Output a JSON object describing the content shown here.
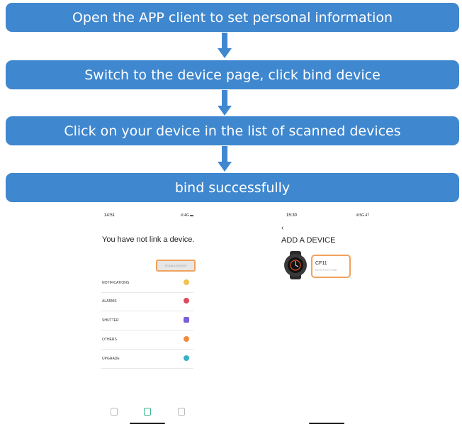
{
  "steps": [
    {
      "label": "Open the APP client to set personal information"
    },
    {
      "label": "Switch to the device page, click bind device"
    },
    {
      "label": "Click on your device in the list of scanned devices"
    },
    {
      "label": "bind successfully"
    }
  ],
  "colors": {
    "step_fill": "#3f87cf",
    "step_text": "#ffffff",
    "highlight": "#f0a25c",
    "arrow": "#3f87cf"
  },
  "left_phone": {
    "time": "14:51",
    "status": "ıll 4G ▬",
    "heading": "You have not link a device.",
    "scan_button": "SCAN A DEVICE",
    "menu": [
      {
        "label": "NOTIFICATIONS",
        "icon": "message-icon",
        "color": "#f2c14e"
      },
      {
        "label": "ALARMS",
        "icon": "alarm-icon",
        "color": "#e0495b"
      },
      {
        "label": "SHUTTER",
        "icon": "camera-icon",
        "color": "#7b5fd6"
      },
      {
        "label": "OTHERS",
        "icon": "gear-icon",
        "color": "#f08a3c"
      },
      {
        "label": "UPGRADE",
        "icon": "upgrade-icon",
        "color": "#38b2c7"
      }
    ]
  },
  "right_phone": {
    "time": "15:30",
    "status": "ıll 5G 47",
    "back": "‹",
    "heading": "ADD A DEVICE",
    "device_name": "CF11",
    "device_mac": "E0:FD:F4:07:70:6D"
  }
}
